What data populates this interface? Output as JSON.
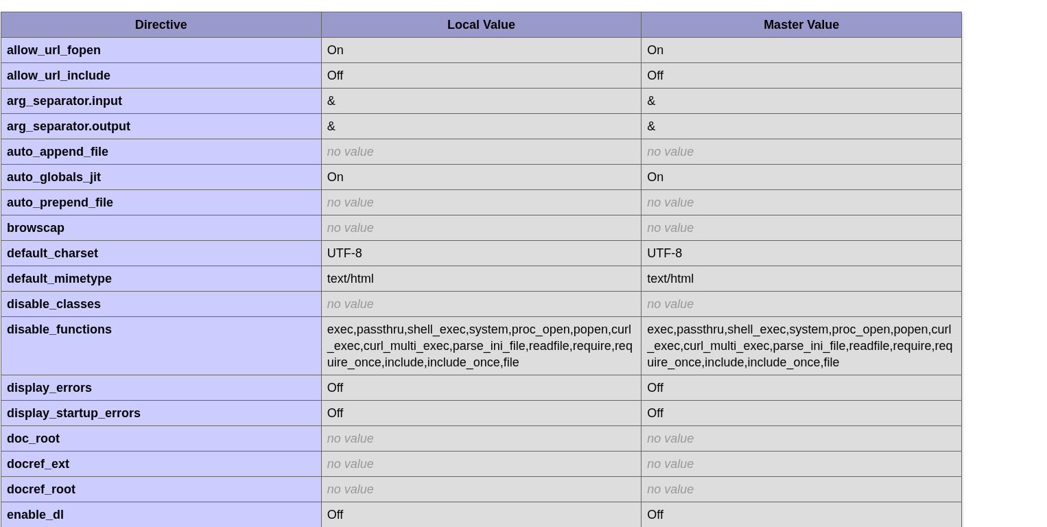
{
  "table": {
    "columns": [
      "Directive",
      "Local Value",
      "Master Value"
    ],
    "rows": [
      {
        "directive": "allow_url_fopen",
        "local": {
          "text": "On",
          "kind": "value"
        },
        "master": {
          "text": "On",
          "kind": "value"
        }
      },
      {
        "directive": "allow_url_include",
        "local": {
          "text": "Off",
          "kind": "value"
        },
        "master": {
          "text": "Off",
          "kind": "value"
        }
      },
      {
        "directive": "arg_separator.input",
        "local": {
          "text": "&",
          "kind": "value"
        },
        "master": {
          "text": "&",
          "kind": "value"
        }
      },
      {
        "directive": "arg_separator.output",
        "local": {
          "text": "&",
          "kind": "value"
        },
        "master": {
          "text": "&",
          "kind": "value"
        }
      },
      {
        "directive": "auto_append_file",
        "local": {
          "text": "no value",
          "kind": "empty"
        },
        "master": {
          "text": "no value",
          "kind": "empty"
        }
      },
      {
        "directive": "auto_globals_jit",
        "local": {
          "text": "On",
          "kind": "value"
        },
        "master": {
          "text": "On",
          "kind": "value"
        }
      },
      {
        "directive": "auto_prepend_file",
        "local": {
          "text": "no value",
          "kind": "empty"
        },
        "master": {
          "text": "no value",
          "kind": "empty"
        }
      },
      {
        "directive": "browscap",
        "local": {
          "text": "no value",
          "kind": "empty"
        },
        "master": {
          "text": "no value",
          "kind": "empty"
        }
      },
      {
        "directive": "default_charset",
        "local": {
          "text": "UTF-8",
          "kind": "value"
        },
        "master": {
          "text": "UTF-8",
          "kind": "value"
        }
      },
      {
        "directive": "default_mimetype",
        "local": {
          "text": "text/html",
          "kind": "value"
        },
        "master": {
          "text": "text/html",
          "kind": "value"
        }
      },
      {
        "directive": "disable_classes",
        "local": {
          "text": "no value",
          "kind": "empty"
        },
        "master": {
          "text": "no value",
          "kind": "empty"
        }
      },
      {
        "directive": "disable_functions",
        "local": {
          "text": "exec,passthru,shell_exec,system,proc_open,popen,curl_exec,curl_multi_exec,parse_ini_file,readfile,require,require_once,include,include_once,file",
          "kind": "value"
        },
        "master": {
          "text": "exec,passthru,shell_exec,system,proc_open,popen,curl_exec,curl_multi_exec,parse_ini_file,readfile,require,require_once,include,include_once,file",
          "kind": "value"
        }
      },
      {
        "directive": "display_errors",
        "local": {
          "text": "Off",
          "kind": "value"
        },
        "master": {
          "text": "Off",
          "kind": "value"
        }
      },
      {
        "directive": "display_startup_errors",
        "local": {
          "text": "Off",
          "kind": "value"
        },
        "master": {
          "text": "Off",
          "kind": "value"
        }
      },
      {
        "directive": "doc_root",
        "local": {
          "text": "no value",
          "kind": "empty"
        },
        "master": {
          "text": "no value",
          "kind": "empty"
        }
      },
      {
        "directive": "docref_ext",
        "local": {
          "text": "no value",
          "kind": "empty"
        },
        "master": {
          "text": "no value",
          "kind": "empty"
        }
      },
      {
        "directive": "docref_root",
        "local": {
          "text": "no value",
          "kind": "empty"
        },
        "master": {
          "text": "no value",
          "kind": "empty"
        }
      },
      {
        "directive": "enable_dl",
        "local": {
          "text": "Off",
          "kind": "value"
        },
        "master": {
          "text": "Off",
          "kind": "value"
        }
      }
    ]
  }
}
